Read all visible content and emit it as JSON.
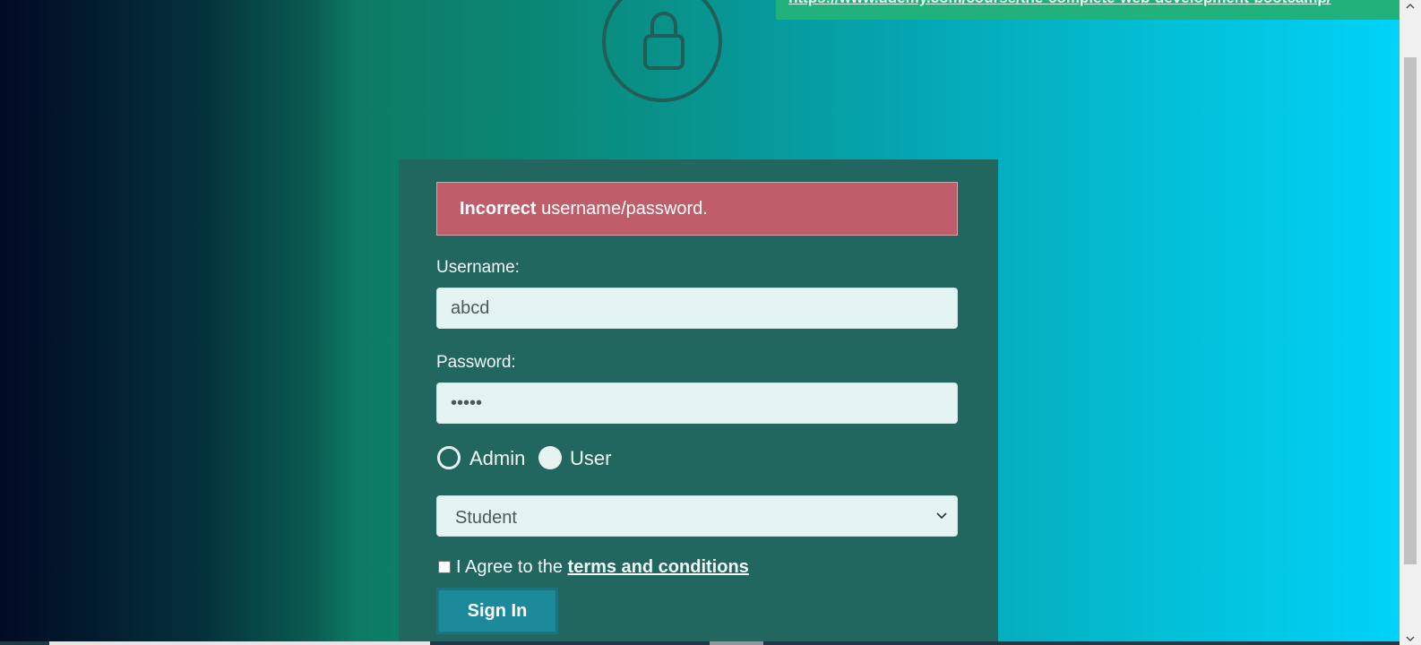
{
  "banner": {
    "text": "https://www.udemy.com/course/the-complete-web-development-bootcamp/"
  },
  "alert": {
    "bold": "Incorrect",
    "message": " username/password."
  },
  "form": {
    "username_label": "Username:",
    "username_value": "abcd",
    "password_label": "Password:",
    "password_value": "abcde",
    "roles": [
      {
        "label": "Admin",
        "selected": true
      },
      {
        "label": "User",
        "selected": false
      }
    ],
    "select_value": "Student",
    "agree_prefix": "I Agree to the ",
    "terms_link": "terms and conditions",
    "signin_label": "Sign In"
  },
  "colors": {
    "panel": "#216760",
    "alert": "#bf5d6a",
    "button": "#1c8a9a",
    "banner": "#21b27b"
  },
  "icons": [
    "lock-icon",
    "chevron-down-icon",
    "scroll-up-icon",
    "scroll-down-icon"
  ]
}
